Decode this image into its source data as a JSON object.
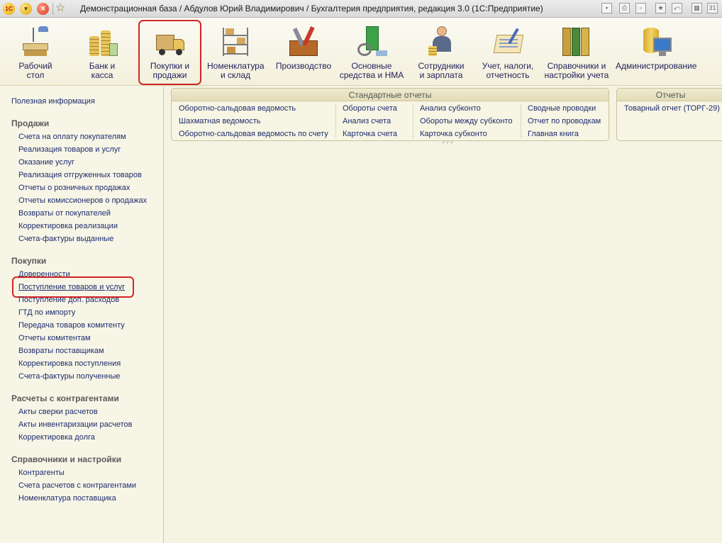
{
  "window": {
    "title": "Демонстрационная база / Абдулов Юрий Владимирович / Бухгалтерия предприятия, редакция 3.0  (1С:Предприятие)",
    "logo_text": "1С"
  },
  "sections": [
    {
      "label": "Рабочий\nстол",
      "icon": "desktop-icon"
    },
    {
      "label": "Банк и\nкасса",
      "icon": "bank-cash-icon"
    },
    {
      "label": "Покупки и\nпродажи",
      "icon": "truck-icon",
      "active": true
    },
    {
      "label": "Номенклатура\nи склад",
      "icon": "warehouse-shelf-icon"
    },
    {
      "label": "Производство",
      "icon": "toolbox-icon"
    },
    {
      "label": "Основные\nсредства и НМА",
      "icon": "fixed-assets-icon"
    },
    {
      "label": "Сотрудники\nи зарплата",
      "icon": "employee-icon"
    },
    {
      "label": "Учет, налоги,\nотчетность",
      "icon": "tax-report-icon"
    },
    {
      "label": "Справочники и\nнастройки учета",
      "icon": "binders-icon"
    },
    {
      "label": "Администрирование",
      "icon": "admin-icon"
    }
  ],
  "nav": {
    "useful_info": "Полезная информация",
    "sales": {
      "heading": "Продажи",
      "items": [
        "Счета на оплату покупателям",
        "Реализация товаров и услуг",
        "Оказание услуг",
        "Реализация отгруженных товаров",
        "Отчеты о розничных продажах",
        "Отчеты комиссионеров о продажах",
        "Возвраты от покупателей",
        "Корректировка реализации",
        "Счета-фактуры выданные"
      ]
    },
    "purchases": {
      "heading": "Покупки",
      "items": [
        "Доверенности",
        "Поступление товаров и услуг",
        "Поступление доп. расходов",
        "ГТД по импорту",
        "Передача товаров комитенту",
        "Отчеты комитентам",
        "Возвраты поставщикам",
        "Корректировка поступления",
        "Счета-фактуры полученные"
      ]
    },
    "counterparties": {
      "heading": "Расчеты с контрагентами",
      "items": [
        "Акты сверки расчетов",
        "Акты инвентаризации расчетов",
        "Корректировка долга"
      ]
    },
    "catalogs": {
      "heading": "Справочники и настройки",
      "items": [
        "Контрагенты",
        "Счета расчетов с контрагентами",
        "Номенклатура поставщика"
      ]
    }
  },
  "standard_reports": {
    "title": "Стандартные отчеты",
    "col1": [
      "Оборотно-сальдовая ведомость",
      "Шахматная ведомость",
      "Оборотно-сальдовая ведомость по счету"
    ],
    "col2": [
      "Обороты счета",
      "Анализ счета",
      "Карточка счета"
    ],
    "col3": [
      "Анализ субконто",
      "Обороты между субконто",
      "Карточка субконто"
    ],
    "col4": [
      "Сводные проводки",
      "Отчет по проводкам",
      "Главная книга"
    ]
  },
  "reports": {
    "title": "Отчеты",
    "items": [
      "Товарный отчет (ТОРГ-29)"
    ]
  },
  "colors": {
    "link": "#1d2c6e",
    "highlight_frame": "#d42525",
    "background": "#f5f3e2"
  }
}
